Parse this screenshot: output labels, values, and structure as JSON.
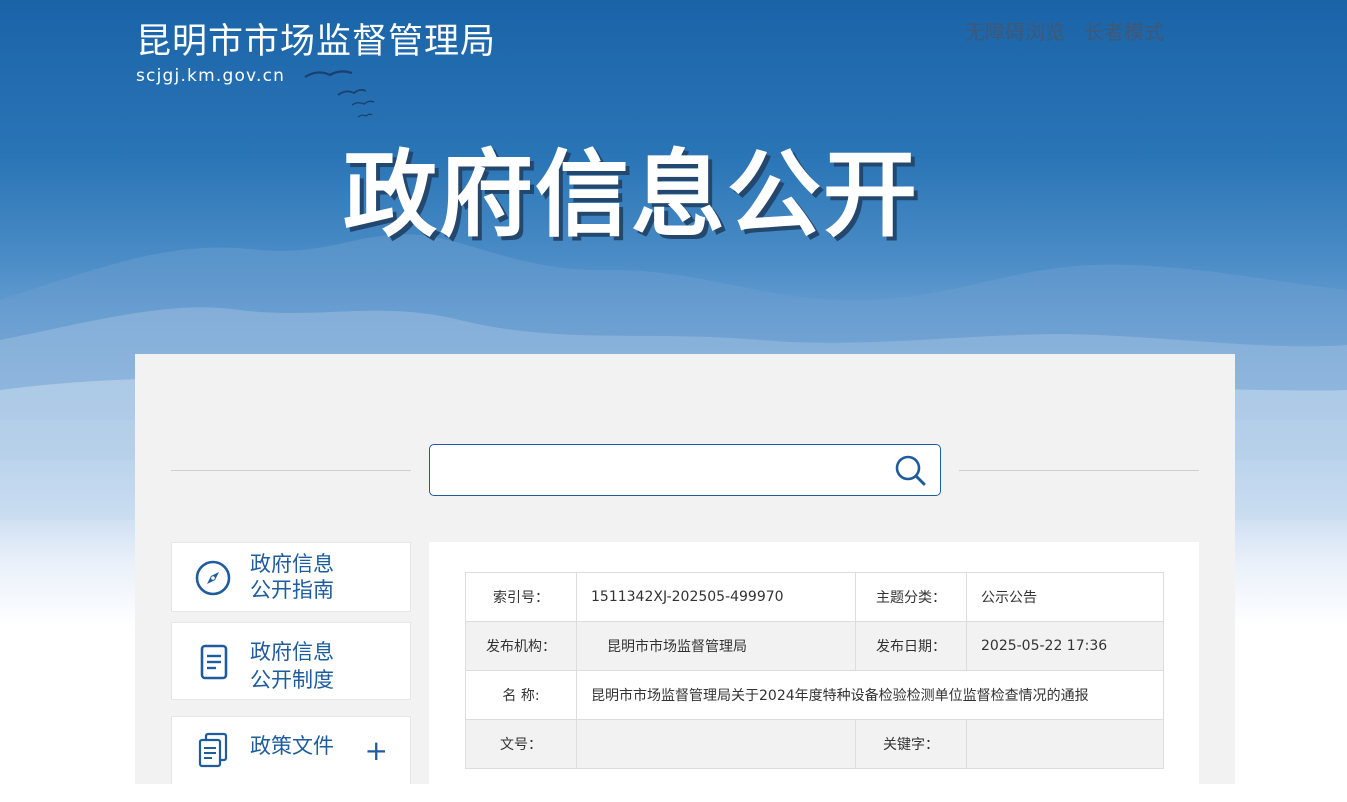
{
  "header": {
    "site_title": "昆明市市场监督管理局",
    "site_domain": "scjgj.km.gov.cn",
    "links": [
      "无障碍浏览",
      "长者模式"
    ],
    "banner_title": "政府信息公开"
  },
  "search": {
    "placeholder": ""
  },
  "sidebar": {
    "items": [
      {
        "line1": "政府信息",
        "line2": "公开指南",
        "icon": "compass-icon"
      },
      {
        "line1": "政府信息",
        "line2": "公开制度",
        "icon": "document-icon"
      },
      {
        "line1": "政策文件",
        "line2": "",
        "icon": "documents-icon",
        "expand": "+"
      }
    ]
  },
  "meta_table": {
    "index_label": "索引号：",
    "index_value": "1511342XJ-202505-499970",
    "topic_label": "主题分类：",
    "topic_value": "公示公告",
    "org_label": "发布机构：",
    "org_value": "昆明市市场监督管理局",
    "date_label": "发布日期：",
    "date_value": "2025-05-22 17:36",
    "name_label": "名 称:",
    "name_value": "昆明市市场监督管理局关于2024年度特种设备检验检测单位监督检查情况的通报",
    "docno_label": "文号：",
    "docno_value": "",
    "keyword_label": "关键字：",
    "keyword_value": ""
  },
  "colors": {
    "brand": "#1f5c9e",
    "panel": "#f2f2f2",
    "sky_top": "#1a63a8"
  }
}
